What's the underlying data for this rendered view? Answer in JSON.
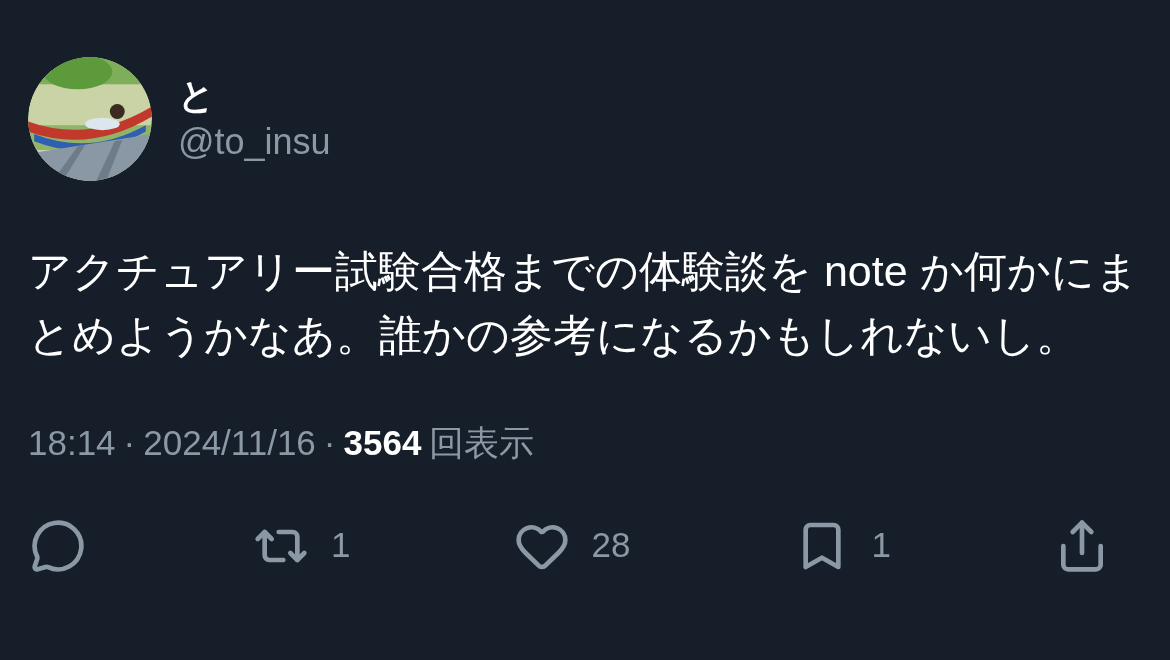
{
  "author": {
    "name": "と",
    "handle": "@to_insu"
  },
  "text": "アクチュアリー試験合格までの体験談を note か何かにまとめようかなあ。誰かの参考になるかもしれないし。",
  "meta": [
    {
      "kind": "plain",
      "text": "18:14"
    },
    {
      "kind": "plain",
      "text": "·"
    },
    {
      "kind": "plain",
      "text": "2024/11/16"
    },
    {
      "kind": "plain",
      "text": "·"
    },
    {
      "kind": "strong",
      "text": "3564"
    },
    {
      "kind": "plain",
      "text": "回表示"
    }
  ],
  "actions": [
    {
      "kind": "reply"
    },
    {
      "kind": "repost",
      "count": "1"
    },
    {
      "kind": "like",
      "count": "28"
    },
    {
      "kind": "bookmark",
      "count": "1"
    },
    {
      "kind": "share"
    }
  ]
}
